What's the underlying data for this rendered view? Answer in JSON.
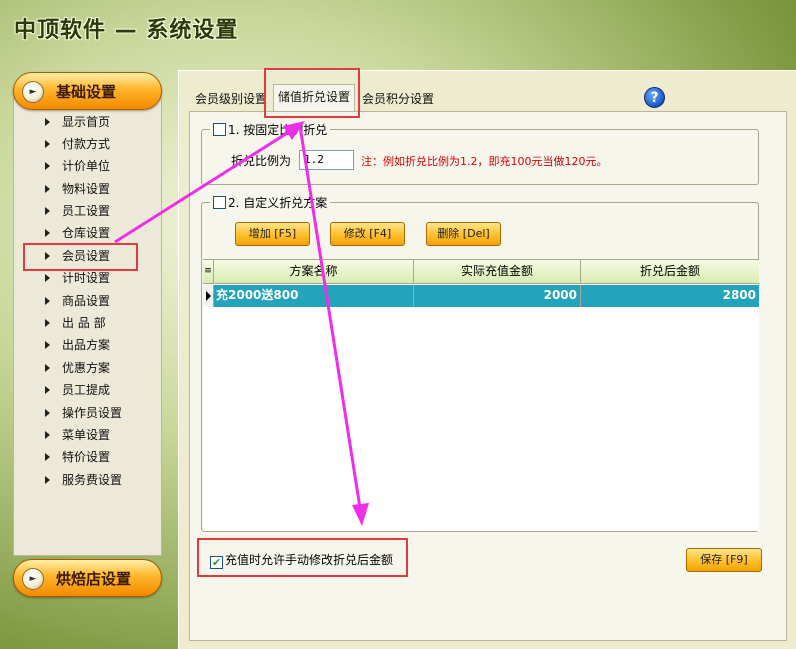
{
  "app": {
    "title": "中顶软件 — 系统设置"
  },
  "sidebar": {
    "top_header": "基础设置",
    "bottom_header": "烘焙店设置",
    "items": [
      "显示首页",
      "付款方式",
      "计价单位",
      "物料设置",
      "员工设置",
      "仓库设置",
      "会员设置",
      "计时设置",
      "商品设置",
      "出 品 部",
      "出品方案",
      "优惠方案",
      "员工提成",
      "操作员设置",
      "菜单设置",
      "特价设置",
      "服务费设置"
    ],
    "selected": "会员设置"
  },
  "tabs": [
    {
      "label": "会员级别设置",
      "active": false
    },
    {
      "label": "储值折兑设置",
      "active": true
    },
    {
      "label": "会员积分设置",
      "active": false
    }
  ],
  "help_icon": "?",
  "group1": {
    "legend": "1. 按固定比例折兑",
    "checked": false,
    "ratio_label": "折兑比例为",
    "ratio_value": "1.2",
    "hint": "注：例如折兑比例为1.2，即充100元当做120元。"
  },
  "group2": {
    "legend": "2. 自定义折兑方案",
    "checked": false,
    "buttons": {
      "add": "增加 [F5]",
      "edit": "修改 [F4]",
      "delete": "删除 [Del]"
    },
    "columns": [
      "方案名称",
      "实际充值金额",
      "折兑后金额"
    ],
    "rows": [
      {
        "name": "充2000送800",
        "actual": "2000",
        "after": "2800"
      }
    ]
  },
  "allow_manual": {
    "checked": true,
    "label": "充值时允许手动修改折兑后金额"
  },
  "save_button": "保存 [F9]",
  "colors": {
    "selected_row": "#23a4bb",
    "annotation_box": "#e53a3a",
    "annotation_arrow": "#ee2ee8",
    "hint_text": "#e00000"
  }
}
